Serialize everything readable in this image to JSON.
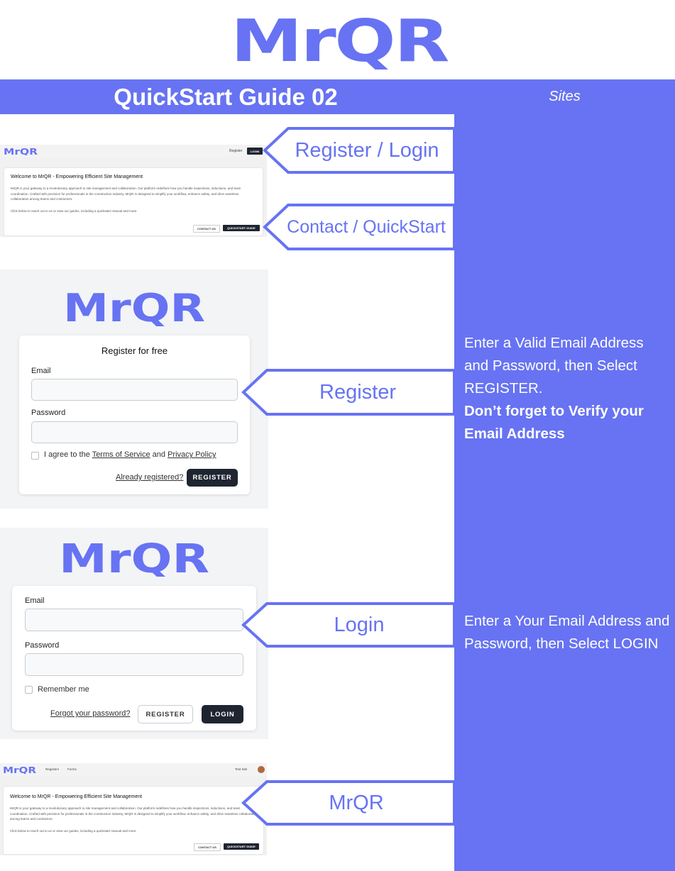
{
  "brand": {
    "logo_text": "MrQR",
    "primary_color": "#6773f2",
    "dark_button_color": "#1f2530"
  },
  "header": {
    "title": "QuickStart Guide 02",
    "section": "Sites"
  },
  "callouts": {
    "register_login": "Register / Login",
    "contact_quickstart": "Contact / QuickStart",
    "register": "Register",
    "login": "Login",
    "mrqr": "MrQR"
  },
  "side_notes": {
    "register_line1": "Enter a Valid Email Address",
    "register_line2": "and Password, then Select",
    "register_line3": "REGISTER.",
    "register_bold1": "Don’t forget to Verify your",
    "register_bold2": "Email Address",
    "login_line1": "Enter a Your Email Address and",
    "login_line2": "Password, then Select LOGIN"
  },
  "home_shot": {
    "nav_register": "Register",
    "nav_login": "LOGIN",
    "welcome_title": "Welcome to MrQR - Empowering Efficient Site Management",
    "para1": "MrQR is your gateway to a revolutionary approach to site management and collaboration. Our platform redefines how you handle inspections, inductions, and team coordination. Crafted with precision for professionals in the construction industry, MrQR is designed to simplify your workflow, enhance safety, and drive seamless collaboration among teams and contractors.",
    "para2": "Click below to reach out to us or view our guides, including a quickstart manual and more.",
    "contact_btn": "CONTACT US",
    "quickstart_btn": "QUICKSTART GUIDE"
  },
  "register_shot": {
    "title": "Register for free",
    "email_label": "Email",
    "password_label": "Password",
    "agree_prefix": "I agree to the",
    "terms_link": "Terms of Service",
    "and_text": "and",
    "privacy_link": "Privacy Policy",
    "already_link": "Already registered?",
    "register_btn": "REGISTER"
  },
  "login_shot": {
    "email_label": "Email",
    "password_label": "Password",
    "remember_label": "Remember me",
    "forgot_link": "Forgot your password?",
    "register_btn": "REGISTER",
    "login_btn": "LOGIN"
  },
  "dashboard_shot": {
    "nav_registers": "Registers",
    "nav_forms": "Forms",
    "site_name": "Test Site",
    "welcome_title": "Welcome to MrQR - Empowering Efficient Site Management",
    "para1": "MrQR is your gateway to a revolutionary approach to site management and collaboration. Our platform redefines how you handle inspections, inductions, and team coordination. Crafted with precision for professionals in the construction industry, MrQR is designed to simplify your workflow, enhance safety, and drive seamless collaboration among teams and contractors.",
    "para2": "Click below to reach out to us or view our guides, including a quickstart manual and more.",
    "contact_btn": "CONTACT US",
    "quickstart_btn": "QUICKSTART GUIDE"
  }
}
